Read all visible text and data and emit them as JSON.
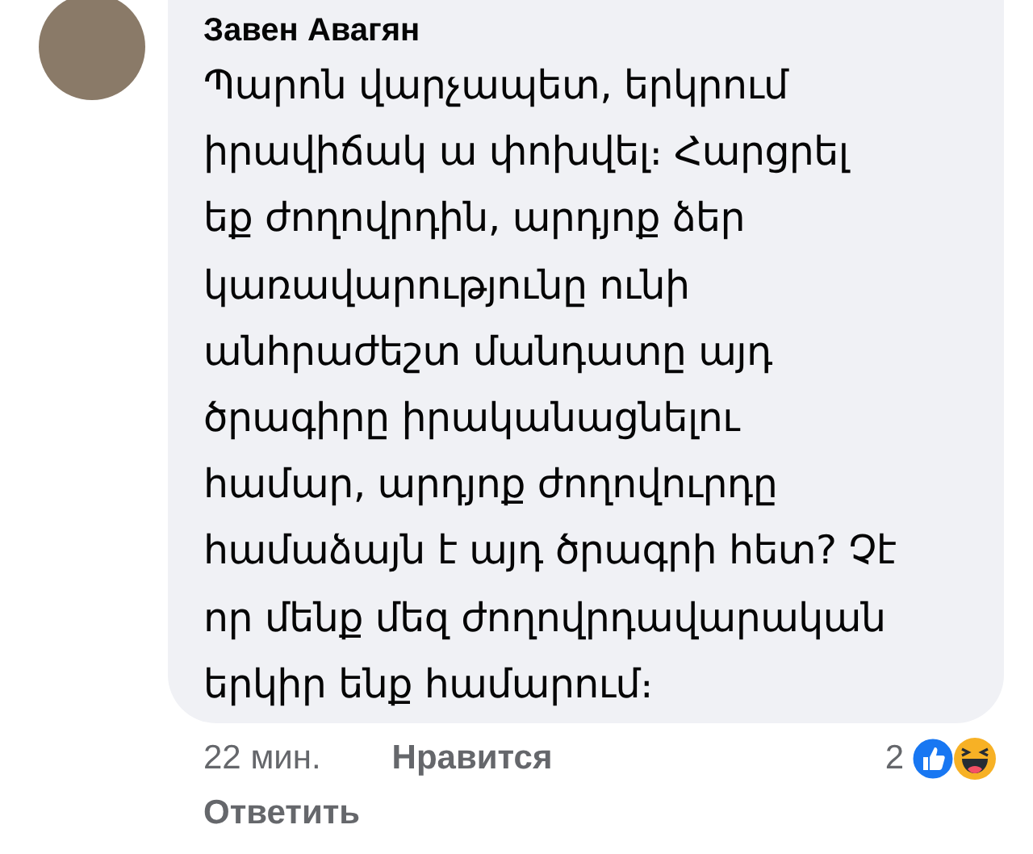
{
  "comment": {
    "author": "Завен Авагян",
    "lines": [
      "Պարոն վարչապետ, երկրում",
      "իրավիճակ ա փոխվել։ Հարցրել",
      "եք ժողովրդին, արդյոք ձեր",
      "կառավարությունը ունի",
      "անհրաժեշտ մանդատը այդ",
      "ծրագիրը իրականացնելու",
      "համար, արդյոք ժողովուրդը",
      "համաձայն է այդ ծրագրի հետ? Չէ",
      "որ մենք մեզ ժողովրդավարական",
      "երկիր ենք համարում։"
    ],
    "time": "22 мин.",
    "like_label": "Нравится",
    "reply_label": "Ответить",
    "reaction_count": "2",
    "reactions": [
      {
        "kind": "like"
      },
      {
        "kind": "haha"
      }
    ]
  }
}
